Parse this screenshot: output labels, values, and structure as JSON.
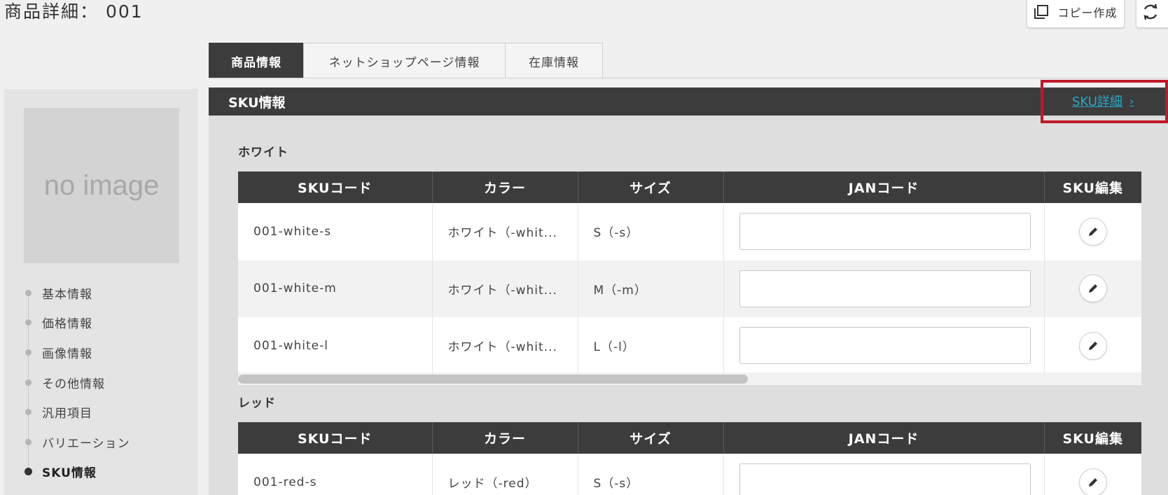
{
  "page": {
    "title": "商品詳細： 001"
  },
  "toolbar": {
    "copy_label": "コピー作成"
  },
  "sidebar": {
    "image_placeholder": "no image",
    "items": [
      {
        "label": "基本情報"
      },
      {
        "label": "価格情報"
      },
      {
        "label": "画像情報"
      },
      {
        "label": "その他情報"
      },
      {
        "label": "汎用項目"
      },
      {
        "label": "バリエーション"
      },
      {
        "label": "SKU情報",
        "active": true
      }
    ]
  },
  "tabs": [
    {
      "label": "商品情報",
      "active": true
    },
    {
      "label": "ネットショップページ情報"
    },
    {
      "label": "在庫情報"
    }
  ],
  "panel": {
    "title": "SKU情報",
    "detail_link": "SKU詳細",
    "columns": [
      "SKUコード",
      "カラー",
      "サイズ",
      "JANコード",
      "SKU編集"
    ],
    "groups": [
      {
        "name": "ホワイト",
        "rows": [
          {
            "code": "001-white-s",
            "color": "ホワイト（-whit...",
            "size": "S（-s）",
            "jan": ""
          },
          {
            "code": "001-white-m",
            "color": "ホワイト（-whit...",
            "size": "M（-m）",
            "jan": ""
          },
          {
            "code": "001-white-l",
            "color": "ホワイト（-whit...",
            "size": "L（-l）",
            "jan": ""
          }
        ]
      },
      {
        "name": "レッド",
        "rows": [
          {
            "code": "001-red-s",
            "color": "レッド（-red）",
            "size": "S（-s）",
            "jan": ""
          }
        ]
      }
    ]
  },
  "colors": {
    "header_bg": "#3c3c3c",
    "link": "#2aa8c5",
    "highlight": "#c0182a"
  }
}
